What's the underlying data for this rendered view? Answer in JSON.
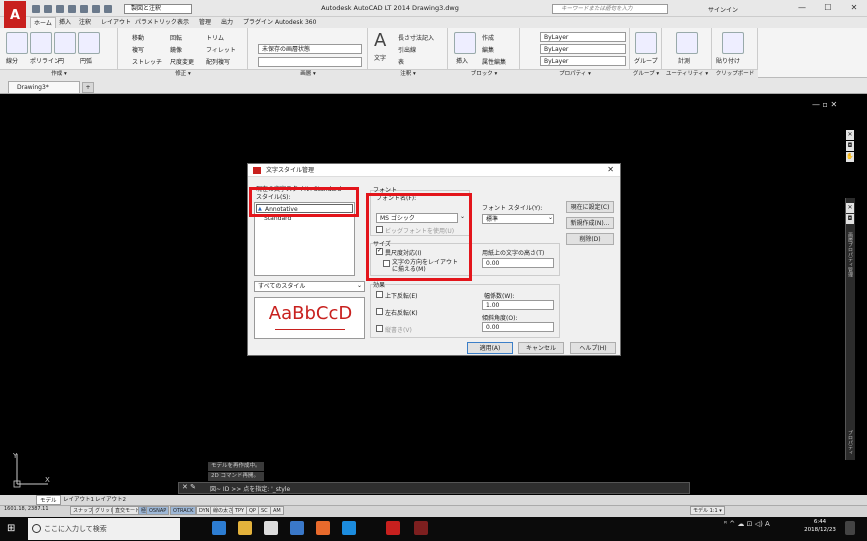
{
  "titlebar": {
    "workspace": "製図と注釈",
    "title": "Autodesk AutoCAD LT 2014    Drawing3.dwg",
    "search_placeholder": "キーワードまたは語句を入力",
    "signin": "サインイン",
    "min": "—",
    "max": "☐",
    "close": "✕"
  },
  "ribbon_tabs": [
    "ホーム",
    "挿入",
    "注釈",
    "レイアウト",
    "パラメトリック",
    "表示",
    "管理",
    "出力",
    "プラグイン",
    "Autodesk 360"
  ],
  "ribbon_groups": [
    "作成 ▾",
    "修正 ▾",
    "画層 ▾",
    "注釈 ▾",
    "ブロック ▾",
    "プロパティ ▾",
    "グループ ▾",
    "ユーティリティ ▾",
    "クリップボード"
  ],
  "ribbon_small": {
    "modify1": "移動",
    "modify2": "回転",
    "modify3": "トリム",
    "modify4": "複写",
    "modify5": "鏡像",
    "modify6": "フィレット",
    "modify7": "ストレッチ",
    "modify8": "尺度変更",
    "modify9": "配列複写",
    "layer_state": "未保存の画層状態",
    "text_big": "文字",
    "dim1": "長さ寸法記入",
    "dim2": "引出線",
    "table": "表",
    "block_create": "作成",
    "block_edit": "編集",
    "block_attr": "属性編集",
    "insert": "挿入",
    "prop1": "ByLayer",
    "prop2": "ByLayer",
    "prop3": "ByLayer",
    "group": "グループ",
    "measure": "計測",
    "paste": "貼り付け",
    "line": "線分",
    "polyline": "ポリライン",
    "circle": "円",
    "arc": "円弧"
  },
  "doc_tab": "Drawing3*",
  "viewport_ctrl": "— ▫ ✕",
  "palette_label": "画層プロパティ管理",
  "palette_label2": "プロパティ",
  "command": {
    "hist1": "モデルを再作成中。",
    "hist2": "2D コマンド再開。",
    "prompt": "図~ ID >> 点を指定: '_style",
    "x": "✕ ✎"
  },
  "layout_tabs": [
    "モデル",
    "レイアウト1",
    "レイアウト2"
  ],
  "status": {
    "coords": "1601.18, 2387.11",
    "items": [
      "スナップ",
      "グリッド",
      "直交モード",
      "極",
      "OSNAP",
      "OTRACK",
      "DYN",
      "線の太さ",
      "TPY",
      "QP",
      "SC",
      "AM"
    ],
    "right": "モデル  1:1 ▾"
  },
  "taskbar": {
    "start": "⊞",
    "search": "ここに入力して検索",
    "tray": "ᴿ ^ ☁ ⊡ ◁) A",
    "time": "6:44",
    "date": "2018/12/23"
  },
  "dialog": {
    "title": "文字スタイル管理",
    "close": "✕",
    "current_style": "現在の文字スタイル: Standard",
    "styles_label": "スタイル(S):",
    "styles": [
      "Annotative",
      "Standard"
    ],
    "filter": "すべてのスタイル",
    "preview": "AaBbCcD",
    "font_group": "フォント",
    "font_name_label": "フォント名(F):",
    "font_name": "MS ゴシック",
    "font_style_label": "フォント スタイル(Y):",
    "font_style": "標準",
    "bigfont": "ビッグフォントを使用(U)",
    "size_group": "サイズ",
    "annotative": "異尺度対応(I)",
    "match_orient": "文字の方向をレイアウトに揃える(M)",
    "height_label": "用紙上の文字の高さ(T)",
    "height": "0.00",
    "effects_group": "効果",
    "upside": "上下反転(E)",
    "backwards": "左右反転(K)",
    "vertical": "縦書き(V)",
    "width_label": "幅係数(W):",
    "width": "1.00",
    "oblique_label": "傾斜角度(O):",
    "oblique": "0.00",
    "btn_current": "現在に設定(C)",
    "btn_new": "新規作成(N)...",
    "btn_delete": "削除(D)",
    "btn_apply": "適用(A)",
    "btn_cancel": "キャンセル",
    "btn_help": "ヘルプ(H)"
  }
}
